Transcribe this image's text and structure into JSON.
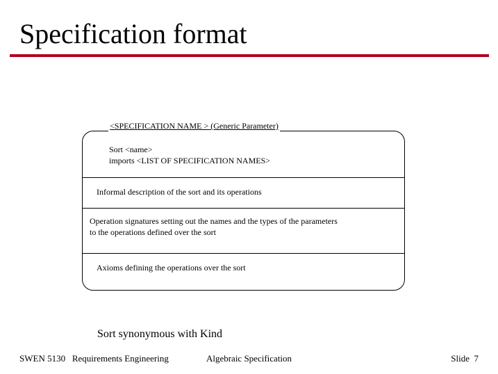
{
  "title": "Specification format",
  "spec_header": {
    "name_part": "<SPECIFICATION NAME >",
    "param_part": " (Generic Parameter)"
  },
  "sections": {
    "sort_line1": "Sort <name>",
    "sort_line2": "imports <LIST OF SPECIFICATION NAMES>",
    "informal": "Informal description of the sort and its operations",
    "opsig_line1": "Operation signatures setting out the names and the types of the parameters",
    "opsig_line2": "to the operations defined over the sort",
    "axioms": "Axioms defining the operations over the sort"
  },
  "caption": "Sort synonymous with Kind",
  "footer": {
    "left_course": "SWEN 5130",
    "left_title": "Requirements Engineering",
    "center": "Algebraic Specification",
    "right_label": "Slide",
    "right_num": "7"
  }
}
